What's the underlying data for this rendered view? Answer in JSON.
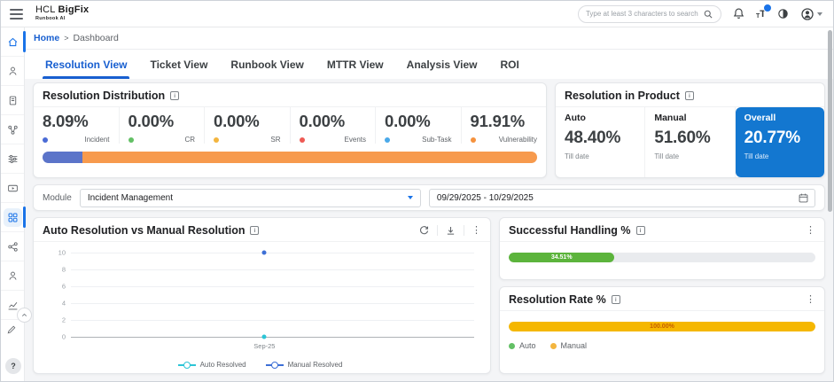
{
  "app": {
    "logo_hcl": "HCL",
    "logo_product": "BigFix",
    "logo_sub": "Runbook AI",
    "search_placeholder": "Type at least 3 characters to search"
  },
  "breadcrumb": {
    "home": "Home",
    "sep": ">",
    "current": "Dashboard"
  },
  "tabs": {
    "active": "Resolution View",
    "items": [
      "Resolution View",
      "Ticket View",
      "Runbook View",
      "MTTR View",
      "Analysis View",
      "ROI"
    ]
  },
  "resolution_distribution": {
    "title": "Resolution Distribution",
    "items": [
      {
        "value": "8.09%",
        "label": "Incident",
        "color": "#4a6bd6"
      },
      {
        "value": "0.00%",
        "label": "CR",
        "color": "#63c065"
      },
      {
        "value": "0.00%",
        "label": "SR",
        "color": "#f3b53f"
      },
      {
        "value": "0.00%",
        "label": "Events",
        "color": "#ee5a54"
      },
      {
        "value": "0.00%",
        "label": "Sub-Task",
        "color": "#4aa9e9"
      },
      {
        "value": "91.91%",
        "label": "Vulnerability",
        "color": "#f5923e"
      }
    ],
    "bar": {
      "segments": [
        {
          "width": "8.09%",
          "color": "#5b74c9"
        },
        {
          "width": "91.91%",
          "color": "#f79a4d"
        }
      ]
    }
  },
  "resolution_in_product": {
    "title": "Resolution in Product",
    "highlight_color": "#1377d0",
    "cards": [
      {
        "label": "Auto",
        "value": "48.40%",
        "sub": "Till date"
      },
      {
        "label": "Manual",
        "value": "51.60%",
        "sub": "Till date"
      },
      {
        "label": "Overall",
        "value": "20.77%",
        "sub": "Till date"
      }
    ]
  },
  "filters": {
    "module_label": "Module",
    "module_value": "Incident Management",
    "date_range": "09/29/2025 - 10/29/2025"
  },
  "chart_data": {
    "type": "line",
    "title": "Auto Resolution vs Manual Resolution",
    "x": [
      "Sep-25"
    ],
    "series": [
      {
        "name": "Auto Resolved",
        "values": [
          0
        ],
        "color": "#2cc5d6"
      },
      {
        "name": "Manual Resolved",
        "values": [
          10
        ],
        "color": "#3d6fd6"
      }
    ],
    "ylim": [
      0,
      10
    ],
    "yticks_desc": [
      "10",
      "8",
      "6",
      "4",
      "2",
      "0"
    ],
    "grid": true,
    "legend_position": "bottom"
  },
  "successful_handling": {
    "title": "Successful Handling %",
    "label": "34.51%",
    "color": "#5cb43c"
  },
  "resolution_rate": {
    "title": "Resolution Rate %",
    "label": "100.00%",
    "color": "#f5b700",
    "label_color": "#c75f00",
    "legend": [
      {
        "label": "Auto",
        "color": "#63c065"
      },
      {
        "label": "Manual",
        "color": "#f3b53f"
      }
    ]
  },
  "sidebar": {
    "icons": [
      "home",
      "runbooks",
      "knowledge-base",
      "integrations",
      "controls",
      "media",
      "dashboard",
      "connections",
      "agents",
      "analytics"
    ],
    "active": "dashboard",
    "bottom_icons": [
      "collapse",
      "edit",
      "help"
    ]
  }
}
